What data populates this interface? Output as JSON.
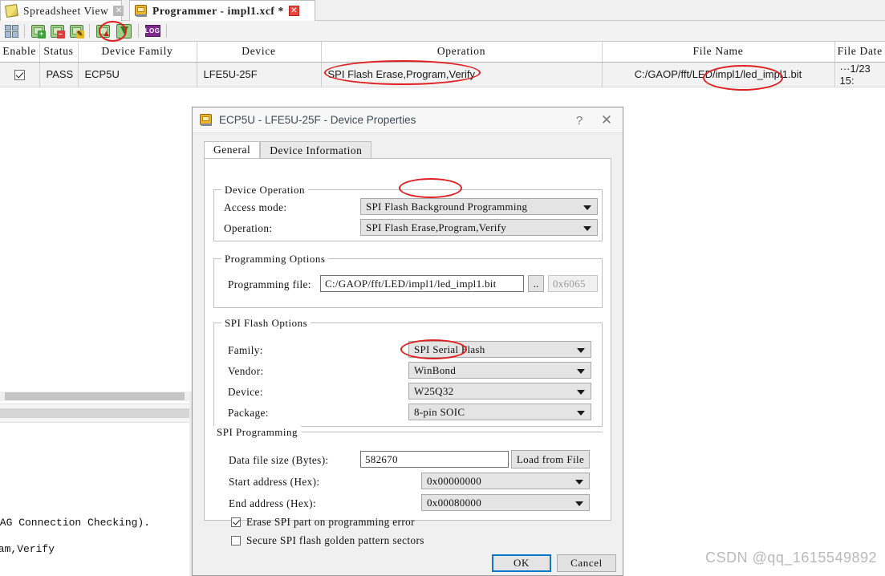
{
  "window": {
    "tabs": [
      {
        "label": "Spreadsheet View",
        "icon": "spreadsheet-icon",
        "active": false,
        "close_icon": "close-icon",
        "close_style": "grey"
      },
      {
        "label": "Programmer - impl1.xcf *",
        "icon": "chip-icon",
        "active": true,
        "close_icon": "close-icon",
        "close_style": "red"
      }
    ]
  },
  "toolbar": {
    "buttons": [
      {
        "name": "scan-device-button",
        "icon": "device-pairs-icon"
      },
      {
        "name": "add-device-button",
        "icon": "chip-plus-icon"
      },
      {
        "name": "remove-device-button",
        "icon": "chip-minus-icon"
      },
      {
        "name": "edit-device-button",
        "icon": "chip-pencil-icon"
      },
      {
        "name": "verify-jtag-button",
        "icon": "chip-warning-icon"
      },
      {
        "name": "program-device-button",
        "icon": "program-download-icon"
      },
      {
        "name": "view-log-button",
        "icon": "log-icon",
        "label": "LOG"
      }
    ]
  },
  "table": {
    "columns": [
      "Enable",
      "Status",
      "Device Family",
      "Device",
      "Operation",
      "File Name",
      "File Date"
    ],
    "rows": [
      {
        "enable": true,
        "status": "PASS",
        "device_family": "ECP5U",
        "device": "LFE5U-25F",
        "operation": "SPI Flash Erase,Program,Verify",
        "file_name": "C:/GAOP/fft/LED/impl1/led_impl1.bit",
        "file_date": "···1/23 15:"
      }
    ]
  },
  "console": {
    "lines": [
      "TAG Connection Checking).",
      "ram,Verify"
    ]
  },
  "dialog": {
    "title": "ECP5U - LFE5U-25F - Device Properties",
    "title_icon": "chip-icon",
    "help_icon": "?",
    "close_icon": "✕",
    "tabs": [
      {
        "label": "General",
        "active": true
      },
      {
        "label": "Device Information",
        "active": false
      }
    ],
    "device_operation": {
      "group_title": "Device Operation",
      "access_mode_label": "Access mode:",
      "access_mode_value": "SPI Flash Background Programming",
      "operation_label": "Operation:",
      "operation_value": "SPI Flash Erase,Program,Verify"
    },
    "programming_options": {
      "group_title": "Programming Options",
      "file_label": "Programming file:",
      "file_value": "C:/GAOP/fft/LED/impl1/led_impl1.bit",
      "browse_label": "..",
      "checksum_value": "0x6065"
    },
    "spi_flash_options": {
      "group_title": "SPI Flash Options",
      "family_label": "Family:",
      "family_value": "SPI Serial Flash",
      "vendor_label": "Vendor:",
      "vendor_value": "WinBond",
      "device_label": "Device:",
      "device_value": "W25Q32",
      "package_label": "Package:",
      "package_value": "8-pin SOIC"
    },
    "spi_programming": {
      "group_title": "SPI Programming",
      "data_file_size_label": "Data file size (Bytes):",
      "data_file_size_value": "582670",
      "load_from_file_label": "Load from File",
      "start_address_label": "Start address (Hex):",
      "start_address_value": "0x00000000",
      "end_address_label": "End address (Hex):",
      "end_address_value": "0x00080000",
      "erase_on_error_label": "Erase SPI part on programming error",
      "erase_on_error_checked": true,
      "secure_golden_label": "Secure SPI flash golden pattern sectors",
      "secure_golden_checked": false
    },
    "footer": {
      "ok_label": "OK",
      "cancel_label": "Cancel"
    }
  },
  "annotations": {
    "color": "#e02020",
    "items": [
      "program-device-toolbar-button",
      "operation-cell",
      "file-name-cell",
      "access-mode-background",
      "vendor-winbond"
    ]
  },
  "watermark": {
    "text": "CSDN @qq_1615549892"
  }
}
